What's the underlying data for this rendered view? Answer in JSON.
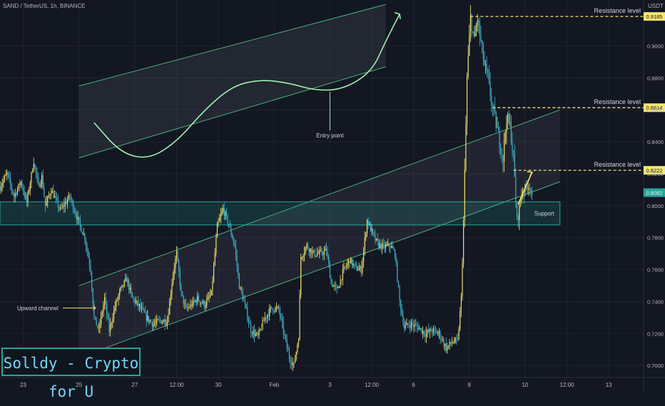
{
  "header": {
    "symbol": "SAND / TetherUS, 1h, BINANCE",
    "unit": "USDT"
  },
  "watermark": "Solldy - Crypto for U",
  "colors": {
    "up": "#f5e66e",
    "down": "#3fb8d2",
    "channel": "#4caf7a",
    "resistance": "#f5e66e",
    "curve": "#9ff2b2",
    "grid": "#1e2230"
  },
  "chart_data": {
    "type": "candlestick",
    "ylim": [
      0.6925,
      0.9288
    ],
    "y_ticks": [
      0.7,
      0.72,
      0.74,
      0.76,
      0.78,
      0.8,
      0.82,
      0.84,
      0.86,
      0.88,
      0.9
    ],
    "y_tick_labels": [
      "0.7000",
      "0.7200",
      "0.7400",
      "0.7600",
      "0.7800",
      "0.8000",
      "0.8200",
      "0.8400",
      "0.8600",
      "0.8800",
      "0.9000"
    ],
    "x_ticks": [
      "23",
      "25",
      "27",
      "12:00",
      "30",
      "Feb",
      "3",
      "12:00",
      "6",
      "8",
      "10",
      "12:00",
      "13"
    ],
    "x_tick_dates": [
      "2022-01-23",
      "2022-01-25",
      "2022-01-27",
      "2022-01-28 12:00",
      "2022-01-30",
      "2022-02-01",
      "2022-02-03",
      "2022-02-04 12:00",
      "2022-02-06",
      "2022-02-08",
      "2022-02-10",
      "2022-02-11 12:00",
      "2022-02-13"
    ],
    "x_range": [
      "2022-01-22 04:00",
      "2022-02-14 06:00"
    ],
    "price_path": [
      [
        "2022-01-22 04:00",
        0.812
      ],
      [
        "2022-01-22 10:00",
        0.82
      ],
      [
        "2022-01-22 16:00",
        0.806
      ],
      [
        "2022-01-22 22:00",
        0.815
      ],
      [
        "2022-01-23 03:00",
        0.802
      ],
      [
        "2022-01-23 09:00",
        0.828
      ],
      [
        "2022-01-23 13:00",
        0.812
      ],
      [
        "2022-01-23 16:00",
        0.818
      ],
      [
        "2022-01-23 19:00",
        0.8
      ],
      [
        "2022-01-24 00:00",
        0.81
      ],
      [
        "2022-01-24 08:00",
        0.797
      ],
      [
        "2022-01-24 16:00",
        0.806
      ],
      [
        "2022-01-24 22:00",
        0.793
      ],
      [
        "2022-01-25 05:00",
        0.78
      ],
      [
        "2022-01-25 10:00",
        0.76
      ],
      [
        "2022-01-25 13:00",
        0.73
      ],
      [
        "2022-01-25 17:00",
        0.722
      ],
      [
        "2022-01-25 22:00",
        0.742
      ],
      [
        "2022-01-26 02:00",
        0.722
      ],
      [
        "2022-01-26 07:00",
        0.737
      ],
      [
        "2022-01-26 11:00",
        0.746
      ],
      [
        "2022-01-26 17:00",
        0.754
      ],
      [
        "2022-01-26 22:00",
        0.742
      ],
      [
        "2022-01-27 04:00",
        0.737
      ],
      [
        "2022-01-27 10:00",
        0.73
      ],
      [
        "2022-01-27 16:00",
        0.726
      ],
      [
        "2022-01-27 22:00",
        0.728
      ],
      [
        "2022-01-28 04:00",
        0.728
      ],
      [
        "2022-01-28 09:00",
        0.758
      ],
      [
        "2022-01-28 12:00",
        0.77
      ],
      [
        "2022-01-28 16:00",
        0.745
      ],
      [
        "2022-01-28 20:00",
        0.735
      ],
      [
        "2022-01-29 01:00",
        0.738
      ],
      [
        "2022-01-29 06:00",
        0.742
      ],
      [
        "2022-01-29 12:00",
        0.738
      ],
      [
        "2022-01-29 18:00",
        0.745
      ],
      [
        "2022-01-29 23:00",
        0.787
      ],
      [
        "2022-01-30 04:00",
        0.798
      ],
      [
        "2022-01-30 09:00",
        0.788
      ],
      [
        "2022-01-30 14:00",
        0.775
      ],
      [
        "2022-01-30 18:00",
        0.75
      ],
      [
        "2022-01-30 22:00",
        0.74
      ],
      [
        "2022-01-31 04:00",
        0.722
      ],
      [
        "2022-01-31 10:00",
        0.718
      ],
      [
        "2022-01-31 16:00",
        0.73
      ],
      [
        "2022-01-31 22:00",
        0.736
      ],
      [
        "2022-02-01 04:00",
        0.735
      ],
      [
        "2022-02-01 09:00",
        0.718
      ],
      [
        "2022-02-01 13:00",
        0.705
      ],
      [
        "2022-02-01 17:00",
        0.7
      ],
      [
        "2022-02-01 21:00",
        0.718
      ],
      [
        "2022-02-01 23:00",
        0.768
      ],
      [
        "2022-02-02 04:00",
        0.775
      ],
      [
        "2022-02-02 10:00",
        0.77
      ],
      [
        "2022-02-02 16:00",
        0.77
      ],
      [
        "2022-02-02 21:00",
        0.772
      ],
      [
        "2022-02-03 01:00",
        0.752
      ],
      [
        "2022-02-03 06:00",
        0.747
      ],
      [
        "2022-02-03 12:00",
        0.76
      ],
      [
        "2022-02-03 17:00",
        0.766
      ],
      [
        "2022-02-03 22:00",
        0.761
      ],
      [
        "2022-02-04 03:00",
        0.76
      ],
      [
        "2022-02-04 08:00",
        0.791
      ],
      [
        "2022-02-04 13:00",
        0.782
      ],
      [
        "2022-02-04 17:00",
        0.776
      ],
      [
        "2022-02-04 22:00",
        0.774
      ],
      [
        "2022-02-05 04:00",
        0.775
      ],
      [
        "2022-02-05 08:00",
        0.77
      ],
      [
        "2022-02-05 12:00",
        0.74
      ],
      [
        "2022-02-05 16:00",
        0.724
      ],
      [
        "2022-02-05 21:00",
        0.726
      ],
      [
        "2022-02-06 04:00",
        0.724
      ],
      [
        "2022-02-06 10:00",
        0.72
      ],
      [
        "2022-02-06 16:00",
        0.722
      ],
      [
        "2022-02-06 22:00",
        0.72
      ],
      [
        "2022-02-07 04:00",
        0.711
      ],
      [
        "2022-02-07 10:00",
        0.715
      ],
      [
        "2022-02-07 14:00",
        0.715
      ],
      [
        "2022-02-07 17:00",
        0.742
      ],
      [
        "2022-02-07 19:00",
        0.79
      ],
      [
        "2022-02-07 22:00",
        0.88
      ],
      [
        "2022-02-08 01:00",
        0.918
      ],
      [
        "2022-02-08 04:00",
        0.903
      ],
      [
        "2022-02-08 07:00",
        0.917
      ],
      [
        "2022-02-08 10:00",
        0.902
      ],
      [
        "2022-02-08 13:00",
        0.888
      ],
      [
        "2022-02-08 16:00",
        0.88
      ],
      [
        "2022-02-08 19:00",
        0.865
      ],
      [
        "2022-02-08 22:00",
        0.855
      ],
      [
        "2022-02-09 02:00",
        0.84
      ],
      [
        "2022-02-09 05:00",
        0.83
      ],
      [
        "2022-02-09 08:00",
        0.855
      ],
      [
        "2022-02-09 11:00",
        0.85
      ],
      [
        "2022-02-09 14:00",
        0.83
      ],
      [
        "2022-02-09 17:00",
        0.79
      ],
      [
        "2022-02-09 19:00",
        0.8
      ],
      [
        "2022-02-09 22:00",
        0.81
      ],
      [
        "2022-02-10 01:00",
        0.812
      ],
      [
        "2022-02-10 04:00",
        0.812
      ],
      [
        "2022-02-10 06:00",
        0.805
      ]
    ],
    "last_price": 0.8082,
    "last_price_label": "0.8082",
    "annotations": {
      "resistance_levels": [
        {
          "label": "Resistance level",
          "price": 0.9185,
          "price_label": "0.9185",
          "x_from": "2022-02-08 01:00"
        },
        {
          "label": "Resistance level",
          "price": 0.8614,
          "price_label": "0.8614",
          "x_from": "2022-02-08 20:00"
        },
        {
          "label": "Resistance level",
          "price": 0.8222,
          "price_label": "0.8222",
          "x_from": "2022-02-09 14:00"
        }
      ],
      "support_zone": {
        "label": "Support",
        "price_from": 0.788,
        "price_to": 0.8025,
        "x_from": "2022-01-22 04:00",
        "x_to": "2022-02-11 06:00"
      },
      "upward_channel": {
        "label": "Upward channel",
        "lower": [
          [
            "2022-01-25 00:00",
            0.705
          ],
          [
            "2022-02-11 06:00",
            0.815
          ]
        ],
        "upper": [
          [
            "2022-01-25 00:00",
            0.75
          ],
          [
            "2022-02-11 06:00",
            0.86
          ]
        ]
      },
      "projection_channel": {
        "lower": [
          [
            "2022-01-25 00:00",
            0.83
          ],
          [
            "2022-02-05 00:00",
            0.887
          ]
        ],
        "upper": [
          [
            "2022-01-25 00:00",
            0.875
          ],
          [
            "2022-02-05 00:00",
            0.926
          ]
        ]
      },
      "projection_curve": [
        [
          "2022-01-25 13:00",
          0.852
        ],
        [
          "2022-01-26 12:00",
          0.833
        ],
        [
          "2022-01-27 12:00",
          0.829
        ],
        [
          "2022-01-28 12:00",
          0.84
        ],
        [
          "2022-01-29 12:00",
          0.86
        ],
        [
          "2022-01-30 12:00",
          0.875
        ],
        [
          "2022-01-31 12:00",
          0.879
        ],
        [
          "2022-02-01 12:00",
          0.877
        ],
        [
          "2022-02-02 12:00",
          0.872
        ],
        [
          "2022-02-03 12:00",
          0.873
        ],
        [
          "2022-02-04 12:00",
          0.884
        ],
        [
          "2022-02-05 00:00",
          0.903
        ],
        [
          "2022-02-05 12:00",
          0.92
        ]
      ],
      "entry_point": {
        "label": "Entry point",
        "x": "2022-02-03 00:00",
        "price": 0.873
      },
      "bounce_arrow": [
        [
          "2022-02-09 18:00",
          0.801
        ],
        [
          "2022-02-10 06:00",
          0.821
        ]
      ]
    }
  }
}
